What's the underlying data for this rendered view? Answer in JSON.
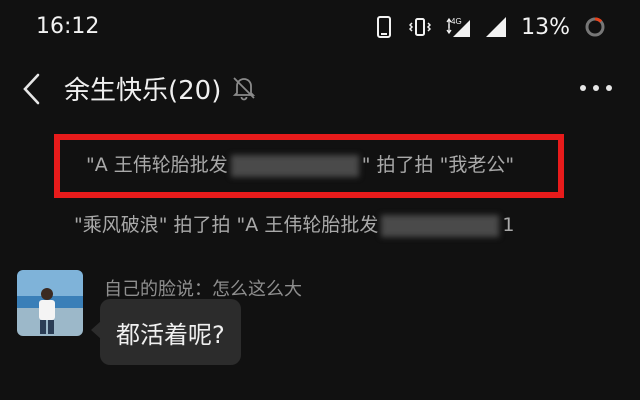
{
  "status_bar": {
    "time": "16:12",
    "network": "4G",
    "battery": "13%"
  },
  "header": {
    "title": "余生快乐(20)"
  },
  "messages": {
    "system_1": {
      "actor": "\"A 王伟轮胎批发",
      "action": "\" 拍了拍 \"我老公\""
    },
    "system_2": {
      "actor": "\"乘风破浪\" 拍了拍 \"A 王伟轮胎批发",
      "tail": "1"
    },
    "chat": {
      "sender": "自己的脸说：怎么这么大",
      "text": "都活着呢?"
    }
  },
  "colors": {
    "background": "#111111",
    "highlight_border": "#e81b1b",
    "bubble": "#2c2c2c"
  }
}
